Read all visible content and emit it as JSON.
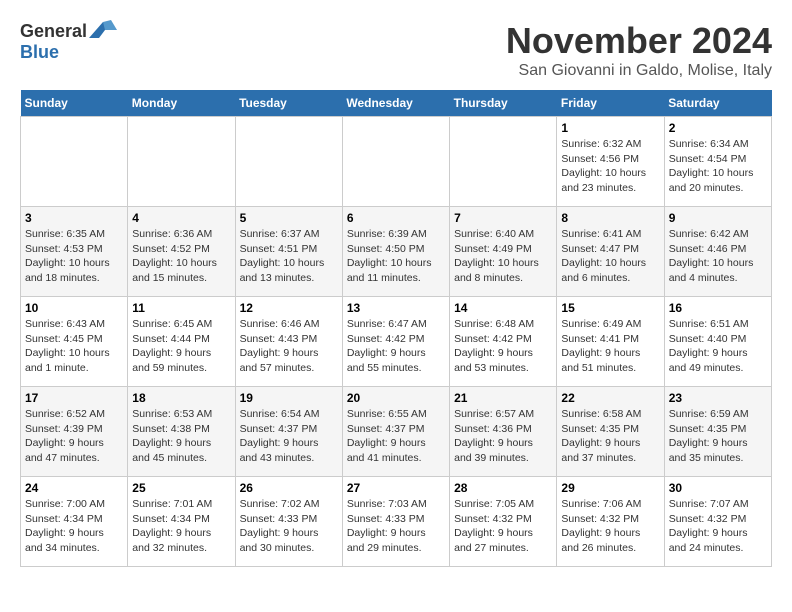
{
  "logo": {
    "general": "General",
    "blue": "Blue"
  },
  "title": "November 2024",
  "location": "San Giovanni in Galdo, Molise, Italy",
  "days_of_week": [
    "Sunday",
    "Monday",
    "Tuesday",
    "Wednesday",
    "Thursday",
    "Friday",
    "Saturday"
  ],
  "weeks": [
    [
      {
        "day": "",
        "info": ""
      },
      {
        "day": "",
        "info": ""
      },
      {
        "day": "",
        "info": ""
      },
      {
        "day": "",
        "info": ""
      },
      {
        "day": "",
        "info": ""
      },
      {
        "day": "1",
        "info": "Sunrise: 6:32 AM\nSunset: 4:56 PM\nDaylight: 10 hours and 23 minutes."
      },
      {
        "day": "2",
        "info": "Sunrise: 6:34 AM\nSunset: 4:54 PM\nDaylight: 10 hours and 20 minutes."
      }
    ],
    [
      {
        "day": "3",
        "info": "Sunrise: 6:35 AM\nSunset: 4:53 PM\nDaylight: 10 hours and 18 minutes."
      },
      {
        "day": "4",
        "info": "Sunrise: 6:36 AM\nSunset: 4:52 PM\nDaylight: 10 hours and 15 minutes."
      },
      {
        "day": "5",
        "info": "Sunrise: 6:37 AM\nSunset: 4:51 PM\nDaylight: 10 hours and 13 minutes."
      },
      {
        "day": "6",
        "info": "Sunrise: 6:39 AM\nSunset: 4:50 PM\nDaylight: 10 hours and 11 minutes."
      },
      {
        "day": "7",
        "info": "Sunrise: 6:40 AM\nSunset: 4:49 PM\nDaylight: 10 hours and 8 minutes."
      },
      {
        "day": "8",
        "info": "Sunrise: 6:41 AM\nSunset: 4:47 PM\nDaylight: 10 hours and 6 minutes."
      },
      {
        "day": "9",
        "info": "Sunrise: 6:42 AM\nSunset: 4:46 PM\nDaylight: 10 hours and 4 minutes."
      }
    ],
    [
      {
        "day": "10",
        "info": "Sunrise: 6:43 AM\nSunset: 4:45 PM\nDaylight: 10 hours and 1 minute."
      },
      {
        "day": "11",
        "info": "Sunrise: 6:45 AM\nSunset: 4:44 PM\nDaylight: 9 hours and 59 minutes."
      },
      {
        "day": "12",
        "info": "Sunrise: 6:46 AM\nSunset: 4:43 PM\nDaylight: 9 hours and 57 minutes."
      },
      {
        "day": "13",
        "info": "Sunrise: 6:47 AM\nSunset: 4:42 PM\nDaylight: 9 hours and 55 minutes."
      },
      {
        "day": "14",
        "info": "Sunrise: 6:48 AM\nSunset: 4:42 PM\nDaylight: 9 hours and 53 minutes."
      },
      {
        "day": "15",
        "info": "Sunrise: 6:49 AM\nSunset: 4:41 PM\nDaylight: 9 hours and 51 minutes."
      },
      {
        "day": "16",
        "info": "Sunrise: 6:51 AM\nSunset: 4:40 PM\nDaylight: 9 hours and 49 minutes."
      }
    ],
    [
      {
        "day": "17",
        "info": "Sunrise: 6:52 AM\nSunset: 4:39 PM\nDaylight: 9 hours and 47 minutes."
      },
      {
        "day": "18",
        "info": "Sunrise: 6:53 AM\nSunset: 4:38 PM\nDaylight: 9 hours and 45 minutes."
      },
      {
        "day": "19",
        "info": "Sunrise: 6:54 AM\nSunset: 4:37 PM\nDaylight: 9 hours and 43 minutes."
      },
      {
        "day": "20",
        "info": "Sunrise: 6:55 AM\nSunset: 4:37 PM\nDaylight: 9 hours and 41 minutes."
      },
      {
        "day": "21",
        "info": "Sunrise: 6:57 AM\nSunset: 4:36 PM\nDaylight: 9 hours and 39 minutes."
      },
      {
        "day": "22",
        "info": "Sunrise: 6:58 AM\nSunset: 4:35 PM\nDaylight: 9 hours and 37 minutes."
      },
      {
        "day": "23",
        "info": "Sunrise: 6:59 AM\nSunset: 4:35 PM\nDaylight: 9 hours and 35 minutes."
      }
    ],
    [
      {
        "day": "24",
        "info": "Sunrise: 7:00 AM\nSunset: 4:34 PM\nDaylight: 9 hours and 34 minutes."
      },
      {
        "day": "25",
        "info": "Sunrise: 7:01 AM\nSunset: 4:34 PM\nDaylight: 9 hours and 32 minutes."
      },
      {
        "day": "26",
        "info": "Sunrise: 7:02 AM\nSunset: 4:33 PM\nDaylight: 9 hours and 30 minutes."
      },
      {
        "day": "27",
        "info": "Sunrise: 7:03 AM\nSunset: 4:33 PM\nDaylight: 9 hours and 29 minutes."
      },
      {
        "day": "28",
        "info": "Sunrise: 7:05 AM\nSunset: 4:32 PM\nDaylight: 9 hours and 27 minutes."
      },
      {
        "day": "29",
        "info": "Sunrise: 7:06 AM\nSunset: 4:32 PM\nDaylight: 9 hours and 26 minutes."
      },
      {
        "day": "30",
        "info": "Sunrise: 7:07 AM\nSunset: 4:32 PM\nDaylight: 9 hours and 24 minutes."
      }
    ]
  ]
}
